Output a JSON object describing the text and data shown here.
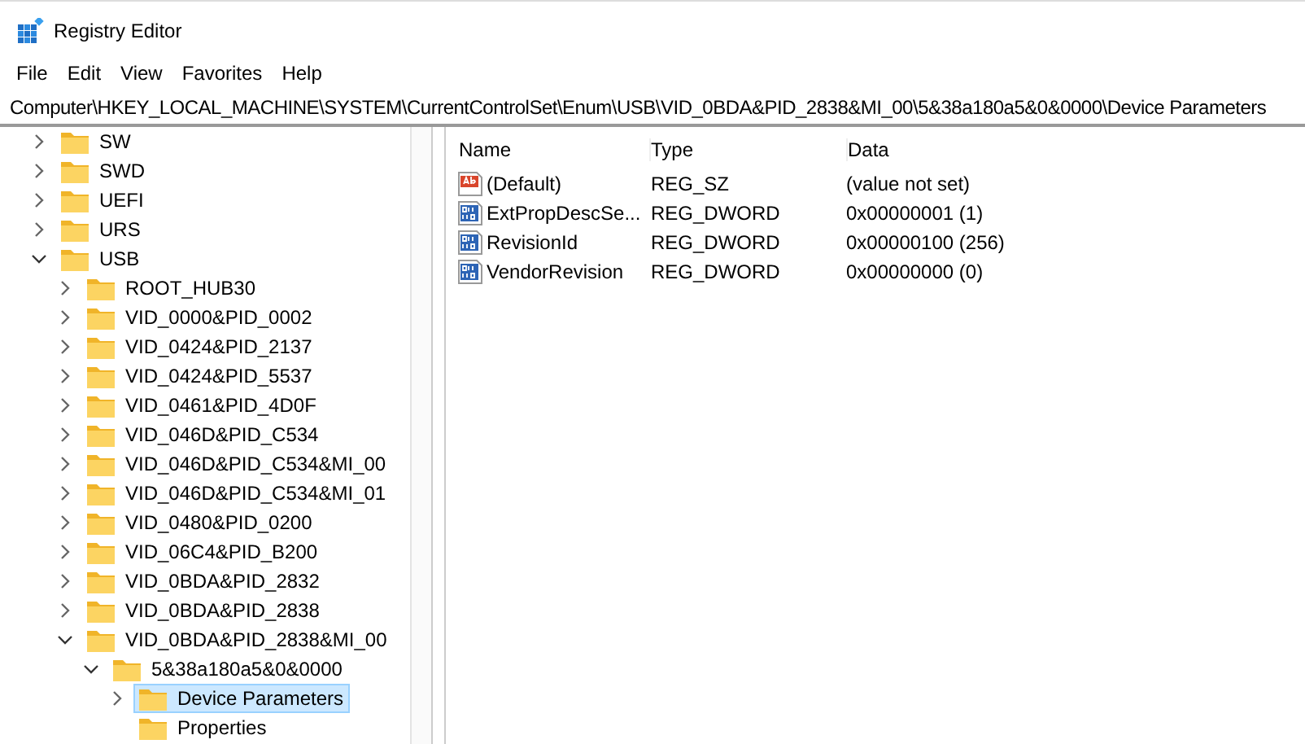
{
  "window": {
    "title": "Registry Editor"
  },
  "menu": [
    "File",
    "Edit",
    "View",
    "Favorites",
    "Help"
  ],
  "address": "Computer\\HKEY_LOCAL_MACHINE\\SYSTEM\\CurrentControlSet\\Enum\\USB\\VID_0BDA&PID_2838&MI_00\\5&38a180a5&0&0000\\Device Parameters",
  "tree": [
    {
      "label": "SW",
      "expanded": false,
      "selected": false
    },
    {
      "label": "SWD",
      "expanded": false,
      "selected": false
    },
    {
      "label": "UEFI",
      "expanded": false,
      "selected": false
    },
    {
      "label": "URS",
      "expanded": false,
      "selected": false
    },
    {
      "label": "USB",
      "expanded": true,
      "selected": false,
      "children": [
        {
          "label": "ROOT_HUB30",
          "expanded": false,
          "selected": false
        },
        {
          "label": "VID_0000&PID_0002",
          "expanded": false,
          "selected": false
        },
        {
          "label": "VID_0424&PID_2137",
          "expanded": false,
          "selected": false
        },
        {
          "label": "VID_0424&PID_5537",
          "expanded": false,
          "selected": false
        },
        {
          "label": "VID_0461&PID_4D0F",
          "expanded": false,
          "selected": false
        },
        {
          "label": "VID_046D&PID_C534",
          "expanded": false,
          "selected": false
        },
        {
          "label": "VID_046D&PID_C534&MI_00",
          "expanded": false,
          "selected": false
        },
        {
          "label": "VID_046D&PID_C534&MI_01",
          "expanded": false,
          "selected": false
        },
        {
          "label": "VID_0480&PID_0200",
          "expanded": false,
          "selected": false
        },
        {
          "label": "VID_06C4&PID_B200",
          "expanded": false,
          "selected": false
        },
        {
          "label": "VID_0BDA&PID_2832",
          "expanded": false,
          "selected": false
        },
        {
          "label": "VID_0BDA&PID_2838",
          "expanded": false,
          "selected": false
        },
        {
          "label": "VID_0BDA&PID_2838&MI_00",
          "expanded": true,
          "selected": false,
          "children": [
            {
              "label": "5&38a180a5&0&0000",
              "expanded": true,
              "selected": false,
              "children": [
                {
                  "label": "Device Parameters",
                  "expanded": false,
                  "selected": true
                },
                {
                  "label": "Properties",
                  "selected": false
                }
              ]
            }
          ]
        }
      ]
    }
  ],
  "values": {
    "columns": [
      "Name",
      "Type",
      "Data"
    ],
    "rows": [
      {
        "kind": "string",
        "name": "(Default)",
        "type": "REG_SZ",
        "data": "(value not set)"
      },
      {
        "kind": "dword",
        "name": "ExtPropDescSe...",
        "type": "REG_DWORD",
        "data": "0x00000001 (1)"
      },
      {
        "kind": "dword",
        "name": "RevisionId",
        "type": "REG_DWORD",
        "data": "0x00000100 (256)"
      },
      {
        "kind": "dword",
        "name": "VendorRevision",
        "type": "REG_DWORD",
        "data": "0x00000000 (0)"
      }
    ]
  }
}
